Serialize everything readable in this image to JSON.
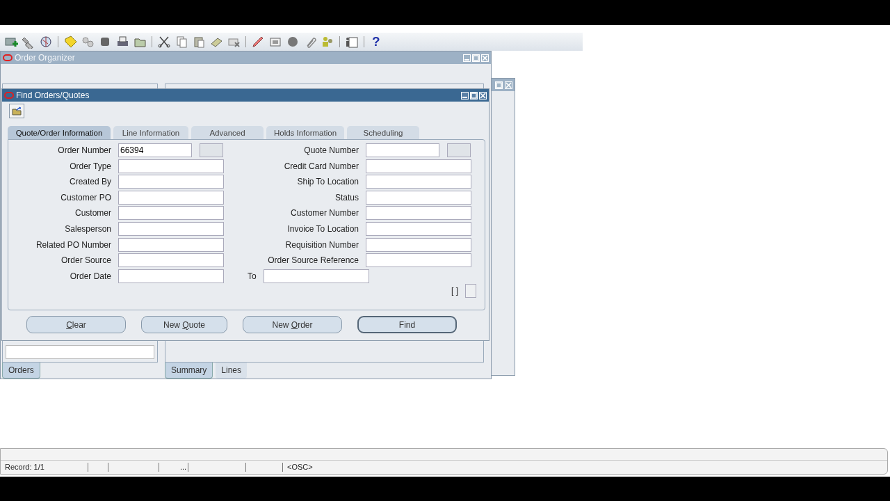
{
  "toolbar": {
    "help": "?"
  },
  "order_organizer": {
    "title": "Order Organizer",
    "active": false,
    "left_tabs": [
      {
        "label": "Orders",
        "selected": true
      }
    ],
    "right_tabs": [
      {
        "label": "Summary",
        "selected": true
      },
      {
        "label": "Lines",
        "selected": false
      }
    ]
  },
  "find_window": {
    "title": "Find  Orders/Quotes",
    "active": true,
    "tabs": [
      {
        "label": "Quote/Order Information",
        "selected": true
      },
      {
        "label": "Line Information",
        "selected": false
      },
      {
        "label": "Advanced",
        "selected": false
      },
      {
        "label": "Holds Information",
        "selected": false
      },
      {
        "label": "Scheduling",
        "selected": false
      }
    ],
    "rows": [
      {
        "left": {
          "label": "Order Number",
          "value": "66394",
          "extra_box": true
        },
        "right": {
          "label": "Quote Number",
          "extra_box": true
        }
      },
      {
        "left": {
          "label": "Order Type"
        },
        "right": {
          "label": "Credit Card Number"
        }
      },
      {
        "left": {
          "label": "Created By"
        },
        "right": {
          "label": "Ship To Location"
        }
      },
      {
        "left": {
          "label": "Customer PO"
        },
        "right": {
          "label": "Status"
        }
      },
      {
        "left": {
          "label": "Customer"
        },
        "right": {
          "label": "Customer Number"
        }
      },
      {
        "left": {
          "label": "Salesperson"
        },
        "right": {
          "label": "Invoice To Location"
        }
      },
      {
        "left": {
          "label": "Related PO Number"
        },
        "right": {
          "label": "Requisition Number"
        }
      },
      {
        "left": {
          "label": "Order Source"
        },
        "right": {
          "label": "Order Source Reference"
        }
      },
      {
        "left": {
          "label": "Order Date"
        },
        "to": {
          "label": "To"
        }
      }
    ],
    "bracket": "[ ]",
    "checkbox": {
      "checked": false
    },
    "buttons": [
      {
        "mnemonic": "C",
        "after": "lear",
        "default": false
      },
      {
        "before": "New ",
        "mnemonic": "Q",
        "after": "uote",
        "default": false
      },
      {
        "before": "New ",
        "mnemonic": "O",
        "after": "rder",
        "default": false
      },
      {
        "before": "Find",
        "default": true
      }
    ]
  },
  "status_bar": {
    "segments": [
      "Record: 1/1",
      "...",
      "<OSC>"
    ]
  }
}
